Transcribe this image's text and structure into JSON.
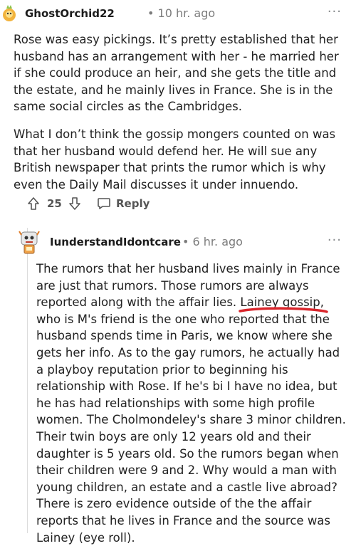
{
  "comments": [
    {
      "username": "GhostOrchid22",
      "time": "• 10 hr. ago",
      "more": "···",
      "paragraphs": [
        "Rose was easy pickings. It’s pretty established that her husband has an arrangement with her - he married her if she could produce an heir, and she gets the title and the estate, and he mainly lives in France. She is in the same social circles as the Cambridges.",
        "What I don’t think the gossip mongers counted on was that her husband would defend her. He will sue any British newspaper that prints the rumor which is why even the Daily Mail discusses it under innuendo."
      ],
      "score": "25",
      "reply_label": "Reply",
      "icons": {
        "avatar": "ghost-orchid-avatar",
        "upvote": "upvote-arrow-icon",
        "downvote": "downvote-arrow-icon",
        "reply": "chat-bubble-icon"
      }
    },
    {
      "username": "IunderstandIdontcare",
      "time": "• 6 hr. ago",
      "more": "···",
      "paragraphs": [
        "The rumors that her husband lives mainly in France are just that rumors. Those rumors are always reported along with the affair lies. Lainey gossip, who is M's friend is the one who reported that the husband spends time in Paris, we know where she gets her info. As to the gay rumors, he actually had a playboy reputation prior to beginning his relationship with Rose. If he's bi I have no idea, but he has had relationships with some high profile women. The Cholmondeley's share 3 minor children. Their twin boys are only 12 years old and their daughter is 5 years old. So the rumors began when their children were 9 and 2. Why would a man with young children, an estate and a castle live abroad? There is zero evidence outside of the the affair reports that he lives in France and the source was Lainey (eye roll)."
      ]
    }
  ],
  "annotation_color": "#d9262c"
}
